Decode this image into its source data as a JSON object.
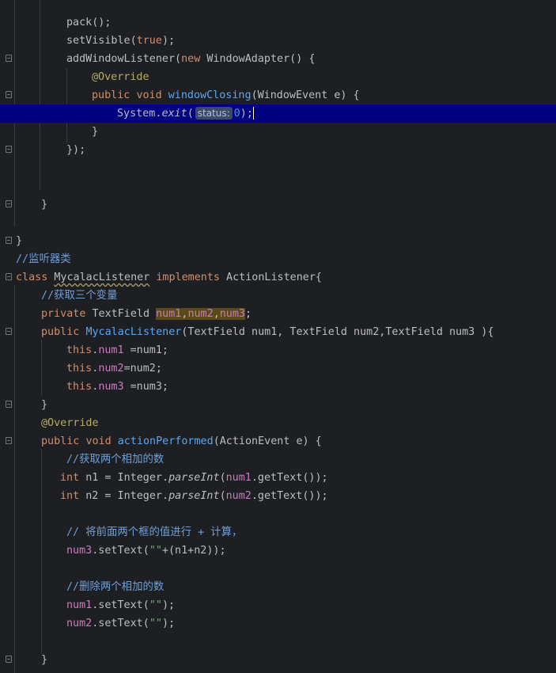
{
  "editor": {
    "lines": {
      "l1": {
        "a": "pack();"
      },
      "l2": {
        "a": "setVisible(",
        "b": "true",
        "c": ");"
      },
      "l3": {
        "a": "addWindowListener(",
        "b": "new",
        "c": " WindowAdapter() {"
      },
      "l4": {
        "a": "@Override"
      },
      "l5": {
        "a": "public",
        "b": " ",
        "c": "void",
        "d": " ",
        "e": "windowClosing",
        "f": "(WindowEvent e) {"
      },
      "l6": {
        "a": "System.",
        "b": "exit",
        "c": "(",
        "hint": "status:",
        "d": "0",
        "e": ");"
      },
      "l7": {
        "a": "}"
      },
      "l8": {
        "a": "});"
      },
      "l11": {
        "a": "}"
      },
      "l13": {
        "a": "}"
      },
      "l14": {
        "a": "//监听器类"
      },
      "l15": {
        "a": "class",
        "b": " ",
        "c": "MycalacListener",
        "d": " ",
        "e": "implements",
        "f": " ActionListener{"
      },
      "l16": {
        "a": "//获取三个变量"
      },
      "l17": {
        "a": "private",
        "b": " TextField ",
        "c": "num1",
        "d": ",",
        "e": "num2",
        "f": ",",
        "g": "num3",
        "h": ";"
      },
      "l18": {
        "a": "public",
        "b": " ",
        "c": "MycalacListener",
        "d": "(TextField num1, TextField num2,TextField num3 ){"
      },
      "l19": {
        "a": "this",
        "b": ".",
        "c": "num1",
        "d": " =num1;"
      },
      "l20": {
        "a": "this",
        "b": ".",
        "c": "num2",
        "d": "=num2;"
      },
      "l21": {
        "a": "this",
        "b": ".",
        "c": "num3",
        "d": " =num3;"
      },
      "l22": {
        "a": "}"
      },
      "l23": {
        "a": "@Override"
      },
      "l24": {
        "a": "public",
        "b": " ",
        "c": "void",
        "d": " ",
        "e": "actionPerformed",
        "f": "(ActionEvent e) {"
      },
      "l25": {
        "a": "//获取两个相加的数"
      },
      "l26": {
        "a": "int",
        "b": " n1 = Integer.",
        "c": "parseInt",
        "d": "(",
        "e": "num1",
        "f": ".getText());"
      },
      "l27": {
        "a": "int",
        "b": " n2 = Integer.",
        "c": "parseInt",
        "d": "(",
        "e": "num2",
        "f": ".getText());"
      },
      "l29": {
        "a": "// 将前面两个框的值进行 + 计算，"
      },
      "l30": {
        "a": "num3",
        "b": ".setText(",
        "c": "\"\"",
        "d": "+(n1+n2));"
      },
      "l32": {
        "a": "//删除两个相加的数"
      },
      "l33": {
        "a": "num1",
        "b": ".setText(",
        "c": "\"\"",
        "d": ");"
      },
      "l34": {
        "a": "num2",
        "b": ".setText(",
        "c": "\"\"",
        "d": ");"
      },
      "l36": {
        "a": "}"
      }
    }
  },
  "colors": {
    "background": "#1e1f22",
    "current_line": "#000080",
    "keyword": "#cf8e6d",
    "method": "#56a8f5",
    "field": "#c77dbb",
    "annotation": "#b3ae60",
    "comment": "#7a7e85",
    "string": "#6aab73",
    "number": "#2aacb8"
  },
  "icons": [
    "fold-open-icon",
    "fold-close-icon"
  ]
}
